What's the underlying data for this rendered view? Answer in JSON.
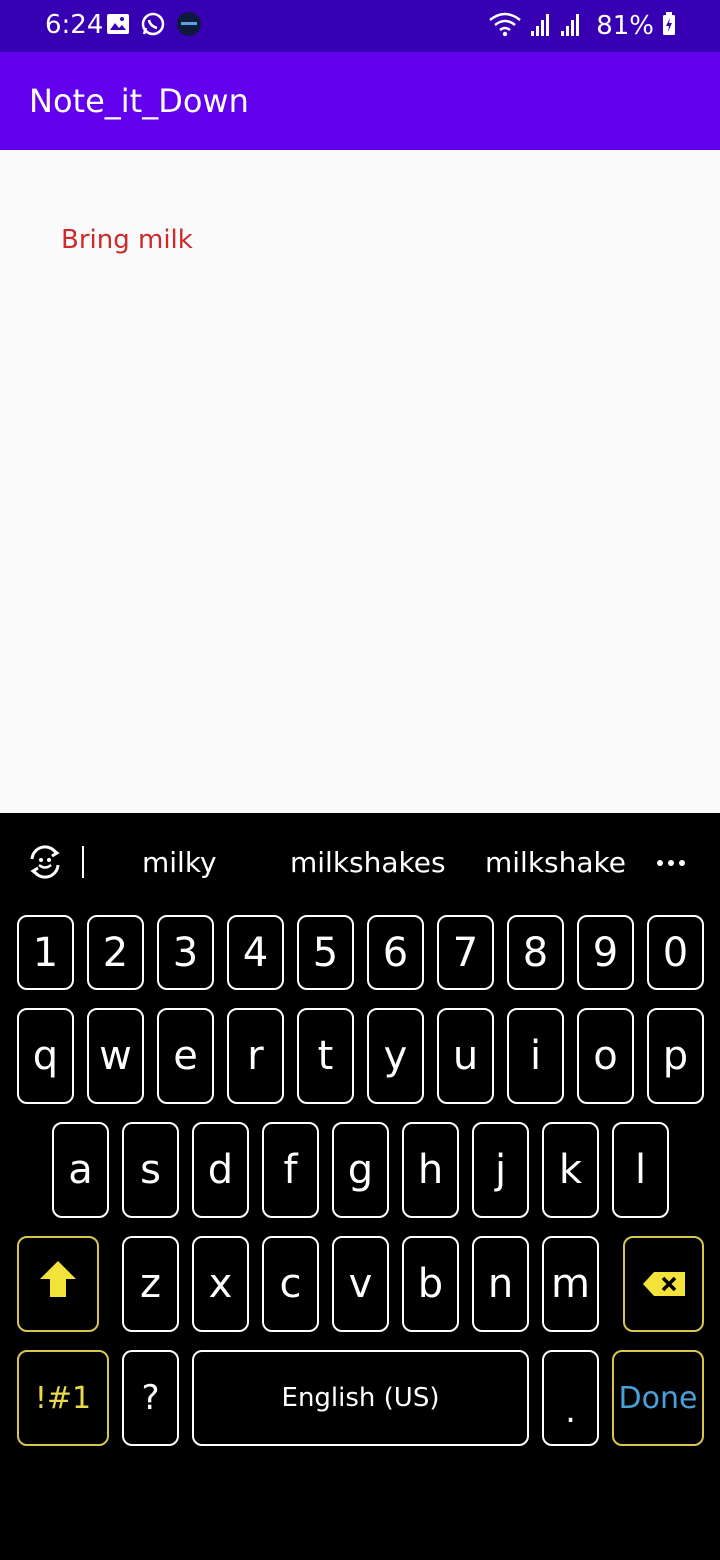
{
  "status_bar": {
    "time": "6:24",
    "battery": "81%"
  },
  "app_bar": {
    "title": "Note_it_Down"
  },
  "content": {
    "note": "Bring milk"
  },
  "keyboard": {
    "suggestions": [
      "milky",
      "milkshakes",
      "milkshake"
    ],
    "row_numbers": [
      "1",
      "2",
      "3",
      "4",
      "5",
      "6",
      "7",
      "8",
      "9",
      "0"
    ],
    "row_q": [
      "q",
      "w",
      "e",
      "r",
      "t",
      "y",
      "u",
      "i",
      "o",
      "p"
    ],
    "row_a": [
      "a",
      "s",
      "d",
      "f",
      "g",
      "h",
      "j",
      "k",
      "l"
    ],
    "row_z": [
      "z",
      "x",
      "c",
      "v",
      "b",
      "n",
      "m"
    ],
    "symbols_label": "!#1",
    "question_label": "?",
    "space_label": "English (US)",
    "period_label": ".",
    "done_label": "Done",
    "colors": {
      "accent_yellow": "#e8d84c",
      "done_blue": "#4aa0d8"
    }
  }
}
